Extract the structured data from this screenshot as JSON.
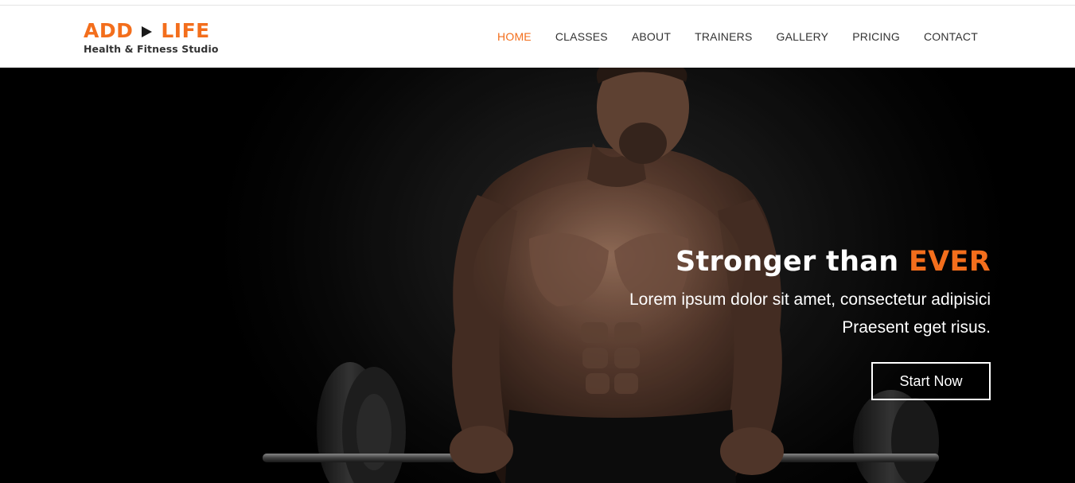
{
  "brand": {
    "name_left": "ADD",
    "name_right": "LIFE",
    "tagline": "Health & Fitness Studio",
    "accent_color": "#f36e1c"
  },
  "nav": {
    "items": [
      {
        "label": "HOME",
        "active": true
      },
      {
        "label": "CLASSES"
      },
      {
        "label": "ABOUT"
      },
      {
        "label": "TRAINERS"
      },
      {
        "label": "GALLERY"
      },
      {
        "label": "PRICING"
      },
      {
        "label": "CONTACT"
      }
    ]
  },
  "hero": {
    "title_prefix": "Stronger than",
    "title_accent": "EVER",
    "subtitle_line1": "Lorem ipsum dolor sit amet, consectetur adipisici",
    "subtitle_line2": "Praesent eget risus.",
    "cta_label": "Start Now"
  }
}
